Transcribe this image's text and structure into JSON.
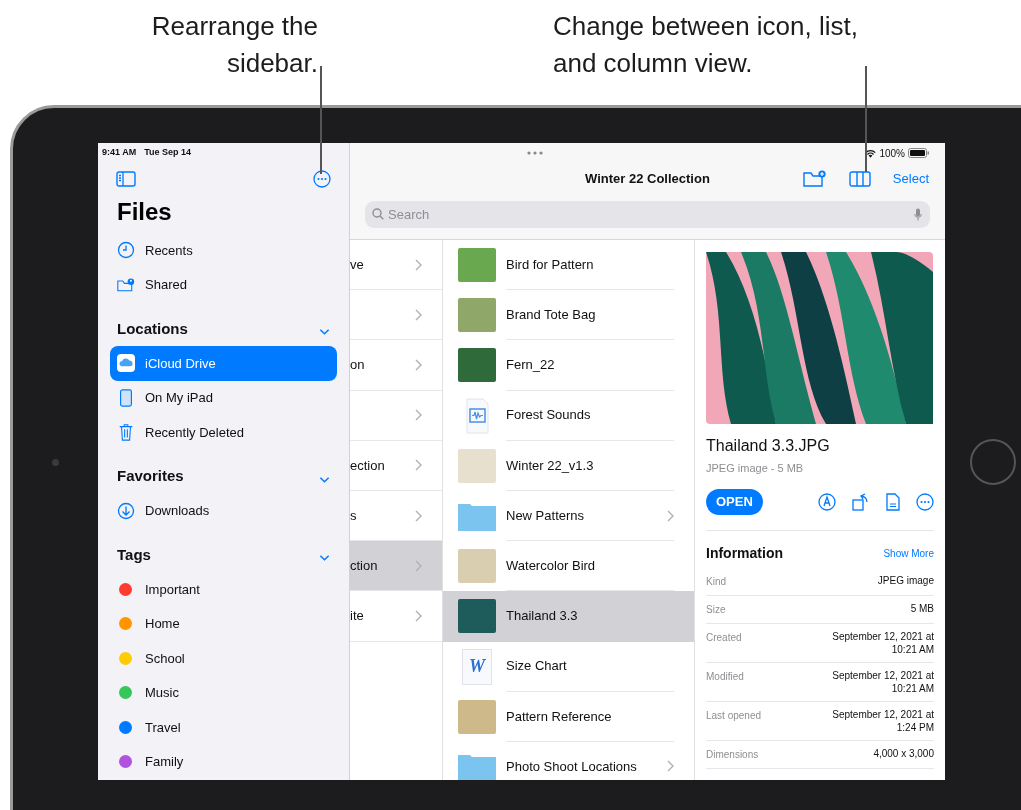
{
  "callouts": [
    {
      "text": "Rearrange the sidebar.",
      "kind": "left"
    },
    {
      "text": "Change between icon, list, and column view.",
      "kind": "right"
    }
  ],
  "status_bar": {
    "time": "9:41 AM",
    "date": "Tue Sep 14",
    "battery": "100%"
  },
  "sidebar": {
    "title": "Files",
    "items": [
      {
        "label": "Recents",
        "kind": "clock",
        "selected": false
      },
      {
        "label": "Shared",
        "kind": "shared",
        "selected": false
      }
    ],
    "sections": [
      {
        "title": "Locations",
        "expanded": true,
        "items": [
          {
            "label": "iCloud Drive",
            "kind": "cloud",
            "selected": true
          },
          {
            "label": "On My iPad",
            "kind": "tablet",
            "selected": false
          },
          {
            "label": "Recently Deleted",
            "kind": "trash",
            "selected": false
          }
        ]
      },
      {
        "title": "Favorites",
        "expanded": true,
        "items": [
          {
            "label": "Downloads",
            "kind": "download",
            "selected": false
          }
        ]
      },
      {
        "title": "Tags",
        "expanded": true,
        "items": [
          {
            "label": "Important",
            "color": "#ff3b30",
            "selected": false
          },
          {
            "label": "Home",
            "color": "#ff9500",
            "selected": false
          },
          {
            "label": "School",
            "color": "#ffcc00",
            "selected": false
          },
          {
            "label": "Music",
            "color": "#34c759",
            "selected": false
          },
          {
            "label": "Travel",
            "color": "#007aff",
            "selected": false
          },
          {
            "label": "Family",
            "color": "#af52de",
            "selected": false
          }
        ]
      }
    ]
  },
  "toolbar": {
    "title": "Winter 22 Collection",
    "select": "Select"
  },
  "search": {
    "placeholder": "Search"
  },
  "column_1": [
    {
      "label": "ve",
      "selected": false
    },
    {
      "selected": false
    },
    {
      "label": "on",
      "selected": false
    },
    {
      "selected": false
    },
    {
      "label": "ection",
      "selected": false
    },
    {
      "label": "s",
      "selected": false
    },
    {
      "label": "ction",
      "selected": true
    },
    {
      "label": "ite",
      "selected": false
    }
  ],
  "column_2": [
    {
      "name": "Bird for Pattern",
      "kind": "photo",
      "selected": false
    },
    {
      "name": "Brand Tote Bag",
      "kind": "photo",
      "selected": false
    },
    {
      "name": "Fern_22",
      "kind": "photo",
      "selected": false
    },
    {
      "name": "Forest Sounds",
      "kind": "audio",
      "selected": false
    },
    {
      "name": "Winter 22_v1.3",
      "kind": "photo",
      "selected": false
    },
    {
      "name": "New Patterns",
      "kind": "folder",
      "selected": false
    },
    {
      "name": "Watercolor Bird",
      "kind": "photo",
      "selected": false
    },
    {
      "name": "Thailand 3.3",
      "kind": "photo",
      "selected": true
    },
    {
      "name": "Size Chart",
      "kind": "word",
      "icon_text": "W",
      "selected": false
    },
    {
      "name": "Pattern Reference",
      "kind": "photo",
      "selected": false
    },
    {
      "name": "Photo Shoot Locations",
      "kind": "folder",
      "selected": false
    }
  ],
  "preview": {
    "name": "Thailand 3.3.JPG",
    "subtitle": "JPEG image - 5 MB",
    "open": "OPEN",
    "info_title": "Information",
    "show_more": "Show More",
    "info": [
      {
        "label": "Kind",
        "value": "JPEG image"
      },
      {
        "label": "Size",
        "value": "5 MB"
      },
      {
        "label": "Created",
        "value": "September 12, 2021 at 10:21 AM"
      },
      {
        "label": "Modified",
        "value": "September 12, 2021 at 10:21 AM"
      },
      {
        "label": "Last opened",
        "value": "September 12, 2021 at 1:24 PM"
      },
      {
        "label": "Dimensions",
        "value": "4,000 x 3,000"
      }
    ]
  }
}
